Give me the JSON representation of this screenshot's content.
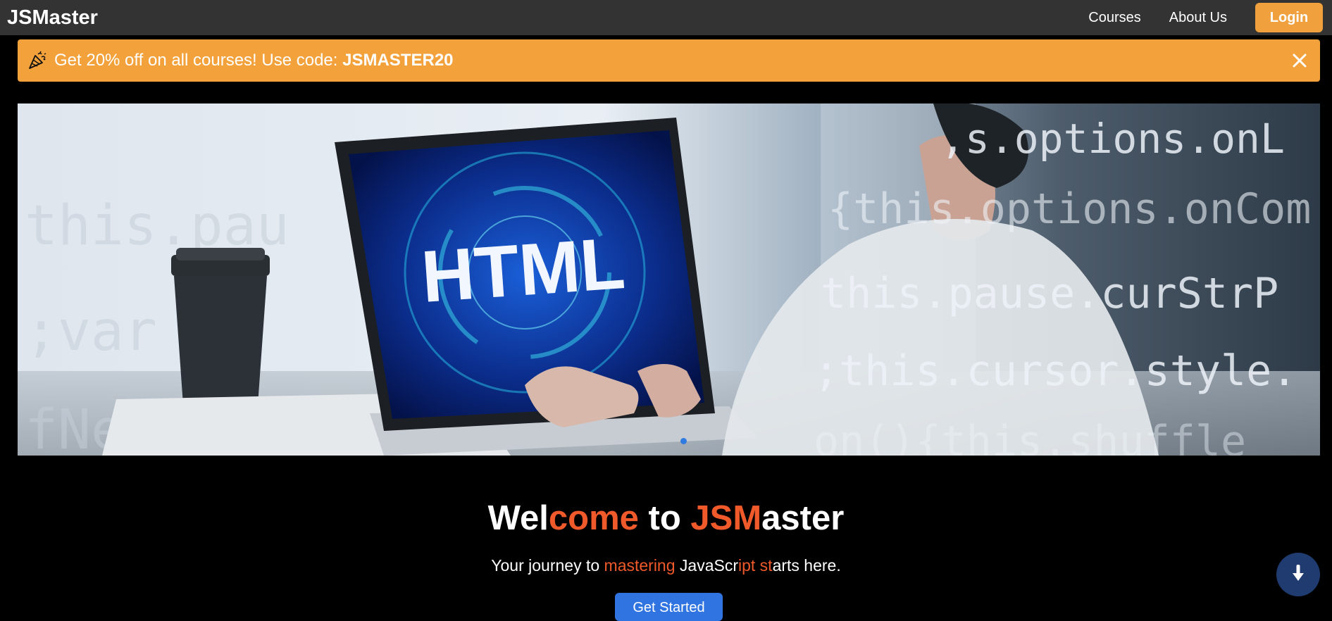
{
  "navbar": {
    "brand": "JSMaster",
    "links": [
      "Courses",
      "About Us"
    ],
    "login_label": "Login"
  },
  "promo": {
    "icon": "party-popper-icon",
    "text": "Get 20% off on all courses! Use code: ",
    "code": "JSMASTER20",
    "close_icon": "close-icon"
  },
  "hero": {
    "screen_text": "HTML",
    "code_lines": [
      ",s.options.onL",
      "{this.options.onCom",
      "this.pause.curStrP",
      ";this.cursor.style.",
      "on(){this.shuffle"
    ],
    "bg_code_left": [
      "this.pau",
      ";var c",
      "fNee"
    ],
    "active_slide": 1
  },
  "welcome": {
    "part1": "Wel",
    "part2": "come",
    "part3": " to ",
    "part4": "JSM",
    "part5": "aster"
  },
  "tagline": {
    "t1": "Your journey to ",
    "t2": "mastering",
    "t3": " JavaScr",
    "t4": "ipt st",
    "t5": "arts here."
  },
  "cta": {
    "label": "Get Started"
  },
  "colors": {
    "navbar": "#333333",
    "promo": "#f3a13a",
    "accent": "#f05a2a",
    "primary": "#2f74e0",
    "scroll_button": "#1f3b6f"
  },
  "scroll_button": {
    "icon": "arrow-down-icon"
  }
}
